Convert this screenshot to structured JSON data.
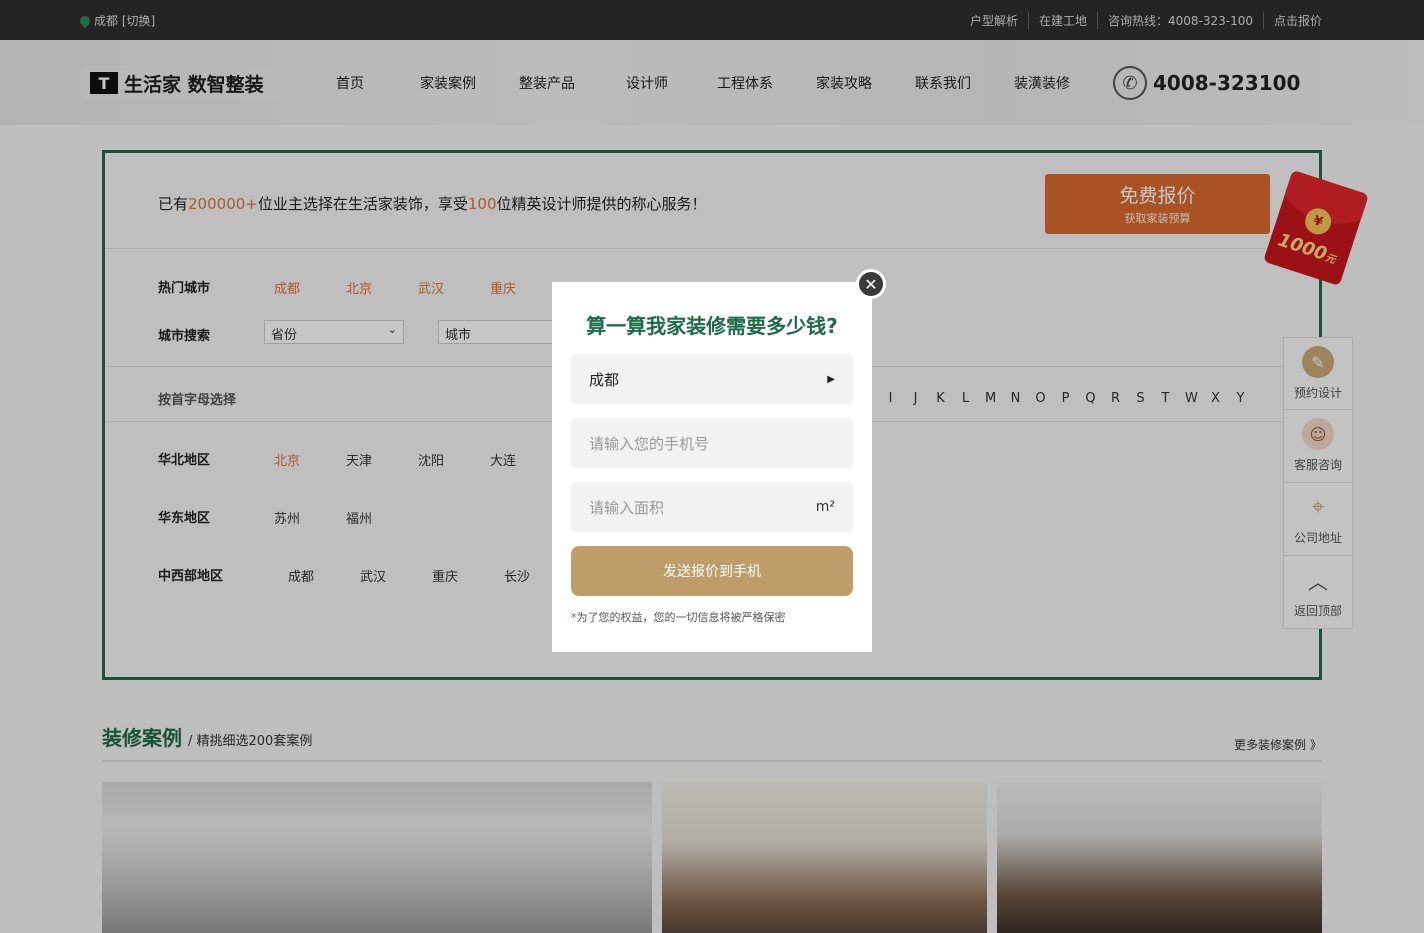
{
  "topbar": {
    "location": "成都 [切换]",
    "links": [
      "户型解析",
      "在建工地",
      "咨询热线：4008-323-100",
      "点击报价"
    ]
  },
  "header": {
    "logo_mark": "T",
    "logo_text": "生活家 数智整装",
    "nav": [
      "首页",
      "家装案例",
      "整装产品",
      "设计师",
      "工程体系",
      "家装攻略",
      "联系我们",
      "装潢装修"
    ],
    "phone": "4008-323100"
  },
  "panel": {
    "promo_prefix": "已有",
    "promo_num1": "200000+",
    "promo_mid": "位业主选择在生活家装饰，享受",
    "promo_num2": "100",
    "promo_suffix": "位精英设计师提供的称心服务！",
    "free_quote": {
      "title": "免费报价",
      "subtitle": "获取家装预算"
    },
    "hot_cities_label": "热门城市",
    "hot_cities": [
      "成都",
      "北京",
      "武汉",
      "重庆"
    ],
    "city_search_label": "城市搜索",
    "province_placeholder": "省份",
    "city_placeholder": "城市",
    "letter_label": "按首字母选择",
    "letters": [
      "I",
      "J",
      "K",
      "L",
      "M",
      "N",
      "O",
      "P",
      "Q",
      "R",
      "S",
      "T",
      "W",
      "X",
      "Y"
    ],
    "regions": [
      {
        "name": "华北地区",
        "cities": [
          "北京",
          "天津",
          "沈阳",
          "大连"
        ]
      },
      {
        "name": "华东地区",
        "cities": [
          "苏州",
          "福州"
        ]
      },
      {
        "name": "中西部地区",
        "cities": [
          "成都",
          "武汉",
          "重庆",
          "长沙"
        ]
      }
    ]
  },
  "red_packet": {
    "amount": "1000",
    "unit": "元",
    "coin": "¥"
  },
  "sidebar": [
    "预约设计",
    "客服咨询",
    "公司地址",
    "返回顶部"
  ],
  "section": {
    "title": "装修案例",
    "subtitle": "/ 精挑细选200套案例",
    "more": "更多装修案例 》"
  },
  "modal": {
    "title": "算一算我家装修需要多少钱?",
    "city_value": "成都",
    "phone_placeholder": "请输入您的手机号",
    "area_placeholder": "请输入面积",
    "area_unit": "m²",
    "submit": "发送报价到手机",
    "note_star": "*",
    "note": "为了您的权益，您的一切信息将被严格保密"
  },
  "colors": {
    "brand_green": "#1d6b4a",
    "accent_orange": "#d9692f",
    "submit_gold": "#bf9d68"
  }
}
